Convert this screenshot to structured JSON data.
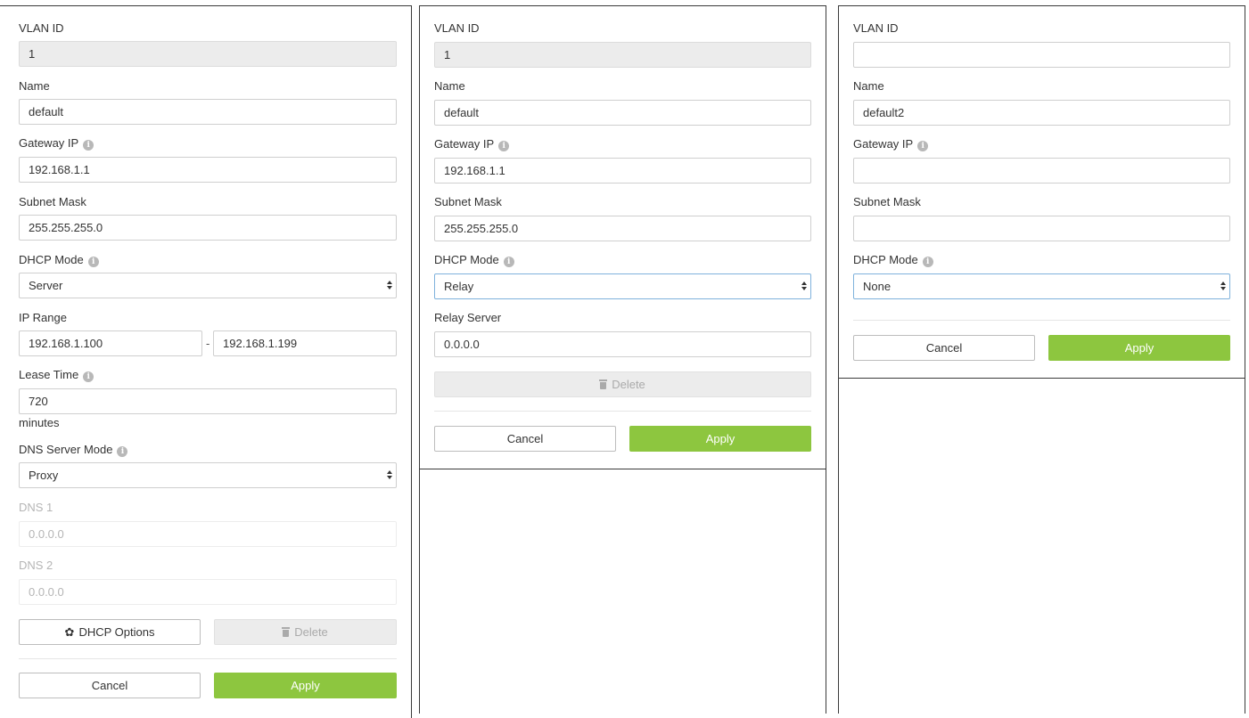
{
  "panel1": {
    "vlan_id_label": "VLAN ID",
    "vlan_id_value": "1",
    "name_label": "Name",
    "name_value": "default",
    "gateway_label": "Gateway IP",
    "gateway_value": "192.168.1.1",
    "subnet_label": "Subnet Mask",
    "subnet_value": "255.255.255.0",
    "dhcp_mode_label": "DHCP Mode",
    "dhcp_mode_value": "Server",
    "ip_range_label": "IP Range",
    "ip_range_start": "192.168.1.100",
    "ip_range_sep": "-",
    "ip_range_end": "192.168.1.199",
    "lease_label": "Lease Time",
    "lease_value": "720",
    "lease_unit": "minutes",
    "dns_mode_label": "DNS Server Mode",
    "dns_mode_value": "Proxy",
    "dns1_label": "DNS 1",
    "dns1_value": "0.0.0.0",
    "dns2_label": "DNS 2",
    "dns2_value": "0.0.0.0",
    "dhcp_options_label": "DHCP Options",
    "delete_label": "Delete",
    "cancel_label": "Cancel",
    "apply_label": "Apply"
  },
  "panel2": {
    "vlan_id_label": "VLAN ID",
    "vlan_id_value": "1",
    "name_label": "Name",
    "name_value": "default",
    "gateway_label": "Gateway IP",
    "gateway_value": "192.168.1.1",
    "subnet_label": "Subnet Mask",
    "subnet_value": "255.255.255.0",
    "dhcp_mode_label": "DHCP Mode",
    "dhcp_mode_value": "Relay",
    "relay_label": "Relay Server",
    "relay_value": "0.0.0.0",
    "delete_label": "Delete",
    "cancel_label": "Cancel",
    "apply_label": "Apply"
  },
  "panel3": {
    "vlan_id_label": "VLAN ID",
    "vlan_id_value": "",
    "name_label": "Name",
    "name_value": "default2",
    "gateway_label": "Gateway IP",
    "gateway_value": "",
    "subnet_label": "Subnet Mask",
    "subnet_value": "",
    "dhcp_mode_label": "DHCP Mode",
    "dhcp_mode_value": "None",
    "cancel_label": "Cancel",
    "apply_label": "Apply"
  },
  "icons": {
    "info": "info-icon",
    "gear": "gear-icon",
    "trash": "trash-icon",
    "caret": "select-caret-icon"
  },
  "colors": {
    "apply_green": "#8dc63f",
    "focus_border": "#7fb2dc",
    "readonly_bg": "#ececec"
  }
}
